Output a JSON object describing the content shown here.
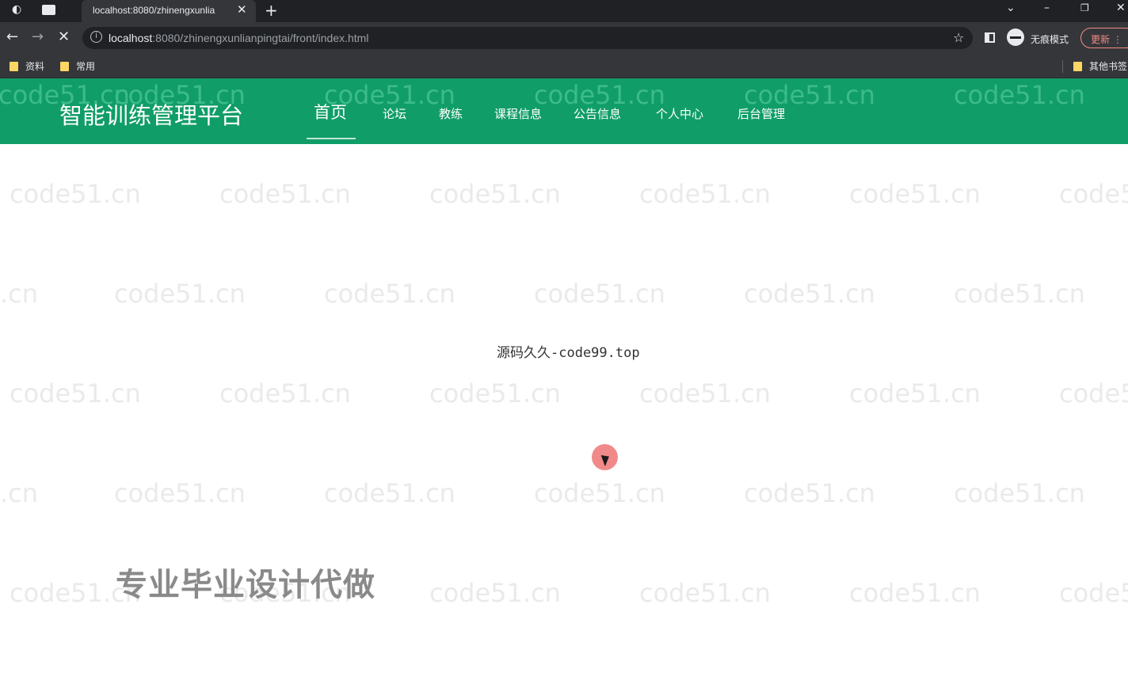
{
  "browser": {
    "tab_title": "localhost:8080/zhinengxunlia",
    "tab_close": "✕",
    "new_tab": "+",
    "url_host": "localhost",
    "url_path": ":8080/zhinengxunlianpingtai/front/index.html",
    "star": "☆",
    "incognito_label": "无痕模式",
    "update_label": "更新",
    "bookmarks": [
      "资料",
      "常用"
    ],
    "other_bookmarks": "其他书签"
  },
  "site": {
    "logo": "智能训练管理平台",
    "nav": [
      "首页",
      "论坛",
      "教练",
      "课程信息",
      "公告信息",
      "个人中心",
      "后台管理"
    ],
    "active_index": 0
  },
  "main": {
    "center_text": "源码久久-code99.top",
    "promo_text": "专业毕业设计代做"
  },
  "watermark": "code51.cn",
  "colors": {
    "brand_green": "#109d68",
    "chrome_dark": "#202124",
    "chrome_toolbar": "#35363a"
  }
}
